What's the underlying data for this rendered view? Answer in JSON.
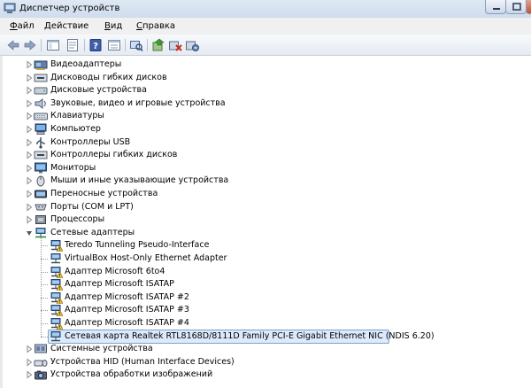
{
  "window": {
    "title": "Диспетчер устройств"
  },
  "menu": [
    {
      "label": "Файл",
      "accel": "Ф"
    },
    {
      "label": "Действие",
      "accel": "Д"
    },
    {
      "label": "Вид",
      "accel": "В"
    },
    {
      "label": "Справка",
      "accel": "С"
    }
  ],
  "toolbar": {
    "buttons": [
      "back-icon",
      "forward-icon",
      "console-tree-icon",
      "properties-list-icon",
      "help-icon",
      "properties-icon",
      "scan-hardware-icon",
      "update-driver-icon",
      "disable-device-icon",
      "uninstall-device-icon"
    ]
  },
  "tree": {
    "categories_top": [
      {
        "label": "Видеоадаптеры",
        "icon": "display-adapter-icon"
      },
      {
        "label": "Дисководы гибких дисков",
        "icon": "floppy-drive-icon"
      },
      {
        "label": "Дисковые устройства",
        "icon": "disk-drive-icon"
      },
      {
        "label": "Звуковые, видео и игровые устройства",
        "icon": "sound-device-icon"
      },
      {
        "label": "Клавиатуры",
        "icon": "keyboard-icon"
      },
      {
        "label": "Компьютер",
        "icon": "computer-icon"
      },
      {
        "label": "Контроллеры USB",
        "icon": "usb-controller-icon"
      },
      {
        "label": "Контроллеры гибких дисков",
        "icon": "floppy-controller-icon"
      },
      {
        "label": "Мониторы",
        "icon": "monitor-icon"
      },
      {
        "label": "Мыши и иные указывающие устройства",
        "icon": "mouse-icon"
      },
      {
        "label": "Переносные устройства",
        "icon": "portable-device-icon"
      },
      {
        "label": "Порты (COM и LPT)",
        "icon": "port-icon"
      },
      {
        "label": "Процессоры",
        "icon": "processor-icon"
      }
    ],
    "network_category": {
      "label": "Сетевые адаптеры",
      "icon": "network-adapter-icon"
    },
    "network_children": [
      {
        "label": "Teredo Tunneling Pseudo-Interface",
        "warning": true
      },
      {
        "label": "VirtualBox Host-Only Ethernet Adapter",
        "warning": false
      },
      {
        "label": "Адаптер Microsoft 6to4",
        "warning": true
      },
      {
        "label": "Адаптер Microsoft ISATAP",
        "warning": true
      },
      {
        "label": "Адаптер Microsoft ISATAP #2",
        "warning": true
      },
      {
        "label": "Адаптер Microsoft ISATAP #3",
        "warning": true
      },
      {
        "label": "Адаптер Microsoft ISATAP #4",
        "warning": true
      },
      {
        "label": "Сетевая карта Realtek RTL8168D/8111D Family PCI-E Gigabit Ethernet NIC (NDIS 6.20)",
        "warning": false,
        "selected": true
      }
    ],
    "categories_bottom": [
      {
        "label": "Системные устройства",
        "icon": "system-device-icon"
      },
      {
        "label": "Устройства HID (Human Interface Devices)",
        "icon": "hid-device-icon"
      },
      {
        "label": "Устройства обработки изображений",
        "icon": "imaging-device-icon"
      }
    ]
  }
}
